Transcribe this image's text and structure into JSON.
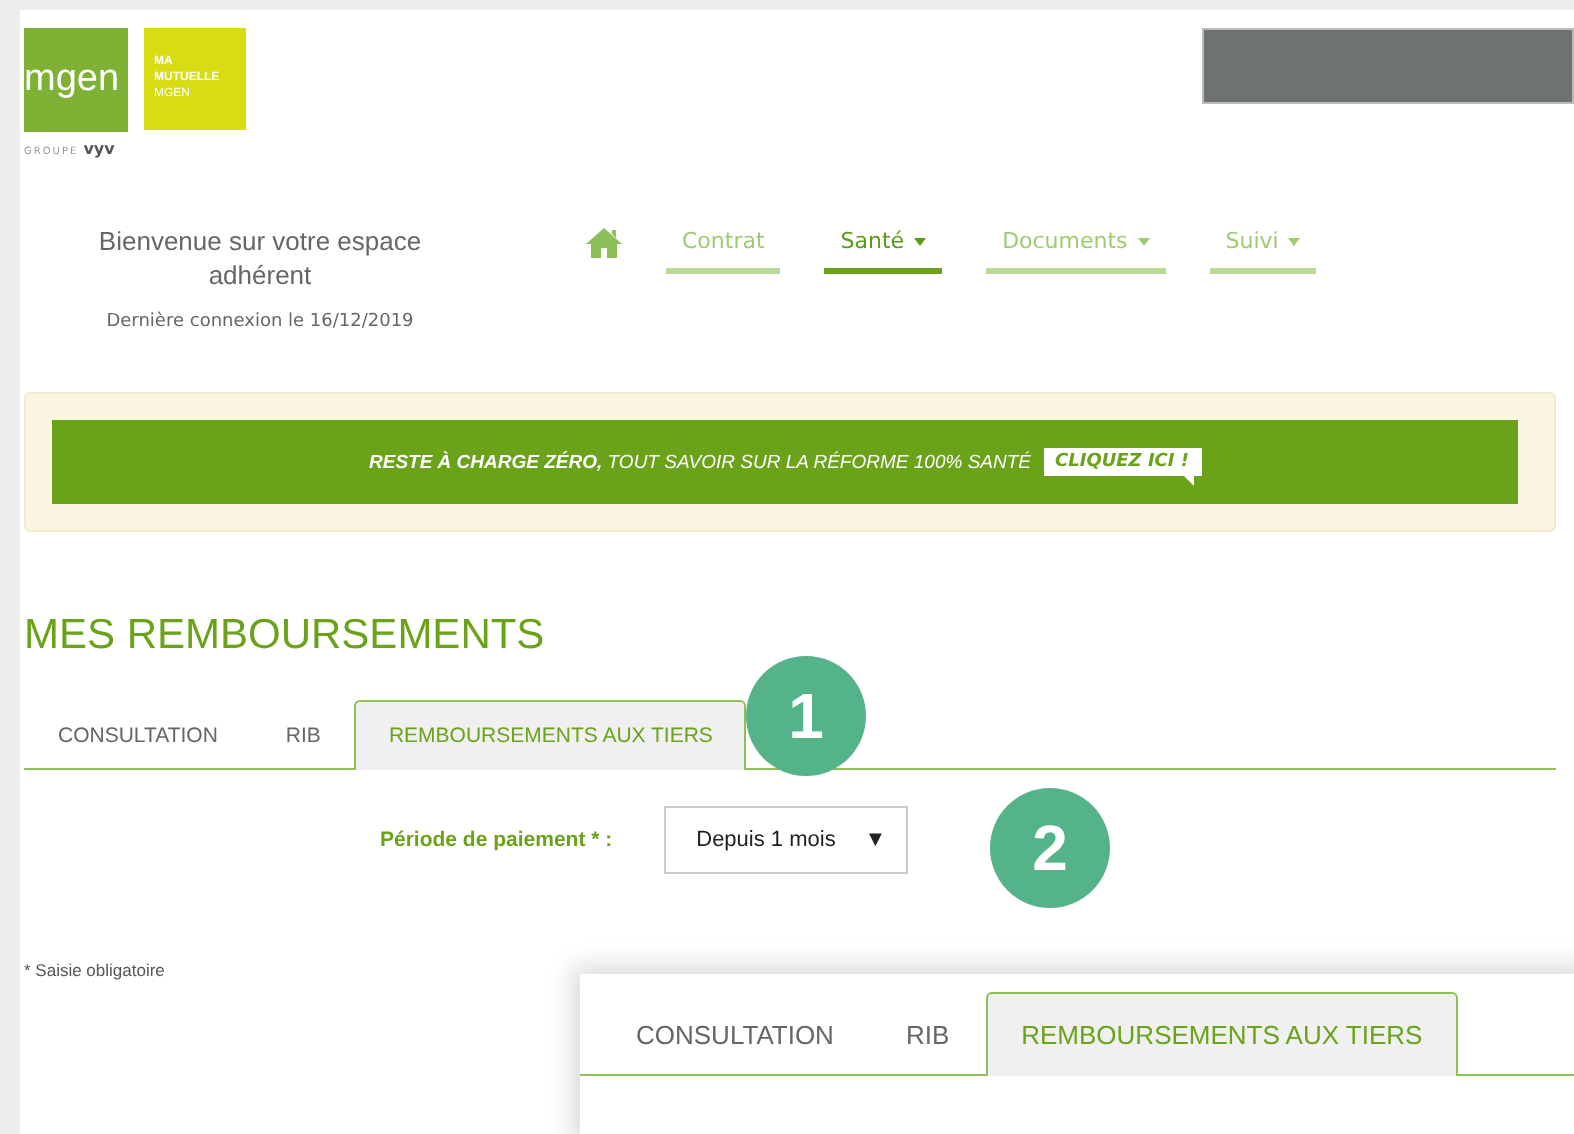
{
  "logo": {
    "brand": "mgen",
    "group_label": "GROUPE",
    "group_name": "vyv",
    "secondary": [
      "MA",
      "MUTUELLE",
      "MGEN"
    ]
  },
  "welcome": {
    "title": "Bienvenue sur votre espace adhérent",
    "last_login": "Dernière connexion le 16/12/2019"
  },
  "nav": [
    {
      "label": "Contrat",
      "selected": false,
      "dropdown": false
    },
    {
      "label": "Santé",
      "selected": true,
      "dropdown": true
    },
    {
      "label": "Documents",
      "selected": false,
      "dropdown": true
    },
    {
      "label": "Suivi",
      "selected": false,
      "dropdown": true
    }
  ],
  "banner": {
    "text": "**RESTE À CHARGE ZÉRO,** TOUT SAVOIR SUR LA RÉFORME 100% SANTÉ",
    "button": "CLIQUEZ ICI !"
  },
  "page_title": "MES REMBOURSEMENTS",
  "tabs": [
    {
      "label": "CONSULTATION",
      "selected": false
    },
    {
      "label": "RIB",
      "selected": false
    },
    {
      "label": "REMBOURSEMENTS AUX TIERS",
      "selected": true
    }
  ],
  "form": {
    "label": "Période de paiement * :",
    "value": "Depuis 1 mois",
    "arrow": "▼"
  },
  "footnote": "* Saisie obligatoire",
  "callouts": [
    "1",
    "2"
  ],
  "inset": {
    "tabs": [
      {
        "label": "CONSULTATION",
        "selected": false
      },
      {
        "label": "RIB",
        "selected": false
      },
      {
        "label": "REMBOURSEMENTS AUX TIERS",
        "selected": true
      }
    ]
  }
}
